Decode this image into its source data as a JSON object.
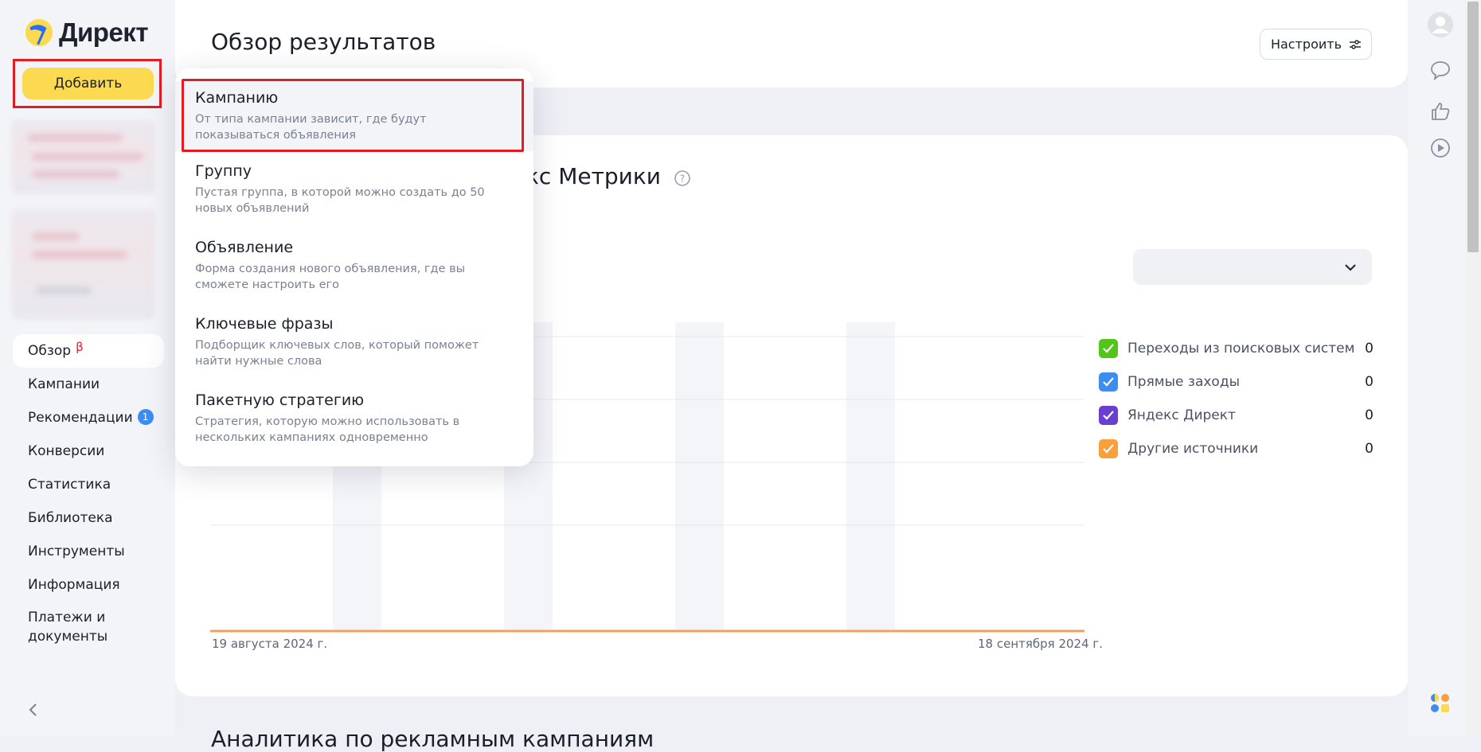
{
  "app": {
    "logo_text": "Директ",
    "add_button": "Добавить"
  },
  "nav": {
    "items": [
      {
        "label": "Обзор",
        "marker": "β"
      },
      {
        "label": "Кампании"
      },
      {
        "label": "Рекомендации",
        "badge": "1"
      },
      {
        "label": "Конверсии"
      },
      {
        "label": "Статистика"
      },
      {
        "label": "Библиотека"
      },
      {
        "label": "Инструменты"
      },
      {
        "label": "Информация"
      },
      {
        "label": "Платежи и документы"
      }
    ]
  },
  "header": {
    "title": "Обзор результатов",
    "configure_button": "Настроить"
  },
  "metrics": {
    "title_visible": "кс Метрики",
    "period_select_value": ""
  },
  "chart_data": {
    "type": "area",
    "x_start_label": "19 августа 2024 г.",
    "x_end_label": "18 сентября 2024 г.",
    "series": [
      {
        "name": "Переходы из поисковых систем",
        "value": 0,
        "color": "#52c41a"
      },
      {
        "name": "Прямые заходы",
        "value": 0,
        "color": "#3d8df0"
      },
      {
        "name": "Яндекс Директ",
        "value": 0,
        "color": "#6a3fd0"
      },
      {
        "name": "Другие источники",
        "value": 0,
        "color": "#f8a03c"
      }
    ]
  },
  "bottom": {
    "title": "Аналитика по рекламным кампаниям"
  },
  "dropdown": {
    "items": [
      {
        "title": "Кампанию",
        "desc": "От типа кампании зависит, где будут показываться объявления"
      },
      {
        "title": "Группу",
        "desc": "Пустая группа, в которой можно создать до 50 новых объявлений"
      },
      {
        "title": "Объявление",
        "desc": "Форма создания нового объявления, где вы сможете настроить его"
      },
      {
        "title": "Ключевые фразы",
        "desc": "Подборщик ключевых слов, который поможет найти нужные слова"
      },
      {
        "title": "Пакетную стратегию",
        "desc": "Стратегия, которую можно использовать в нескольких кампаниях одновременно"
      }
    ]
  },
  "colors": {
    "accent_yellow": "#fbd950",
    "highlight_red": "#e31b23",
    "badge_blue": "#3d8df0",
    "chart_axis_orange": "#f0a060"
  },
  "icons": {
    "rail": [
      "avatar",
      "chat-icon",
      "thumbs-up-icon",
      "play-icon"
    ],
    "bottom_right": "services-grid-icon"
  }
}
